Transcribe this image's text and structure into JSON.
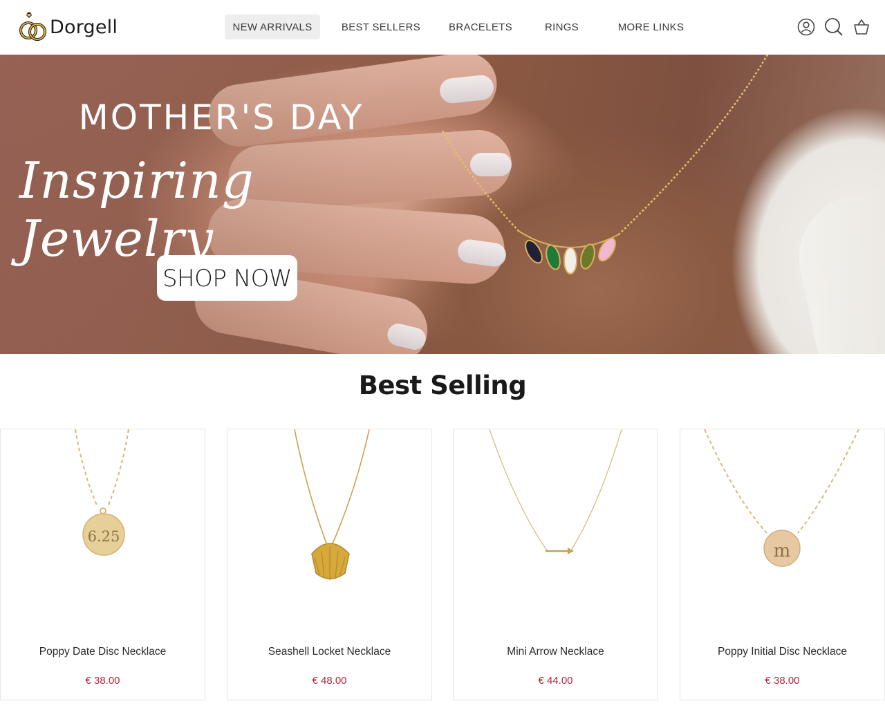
{
  "brand": {
    "name": "Dorgell"
  },
  "nav": [
    {
      "label": "NEW ARRIVALS",
      "active": true
    },
    {
      "label": "BEST SELLERS",
      "active": false
    },
    {
      "label": "BRACELETS",
      "active": false
    },
    {
      "label": "RINGS",
      "active": false
    },
    {
      "label": "MORE LINKS",
      "active": false
    }
  ],
  "header_icons": [
    "account-icon",
    "search-icon",
    "cart-icon"
  ],
  "hero": {
    "title": "MOTHER'S DAY",
    "script": "Inspiring Jewelry",
    "cta": "SHOP NOW"
  },
  "best_selling": {
    "title": "Best Selling",
    "products": [
      {
        "name": "Poppy Date Disc Necklace",
        "price": "€ 38.00",
        "engraving": "6.25"
      },
      {
        "name": "Seashell Locket Necklace",
        "price": "€ 48.00"
      },
      {
        "name": "Mini Arrow Necklace",
        "price": "€ 44.00"
      },
      {
        "name": "Poppy Initial Disc Necklace",
        "price": "€ 38.00",
        "engraving": "m"
      }
    ]
  },
  "colors": {
    "price": "#b3243b",
    "gold": "#c9a45c",
    "active_nav_bg": "#eeeeee"
  }
}
